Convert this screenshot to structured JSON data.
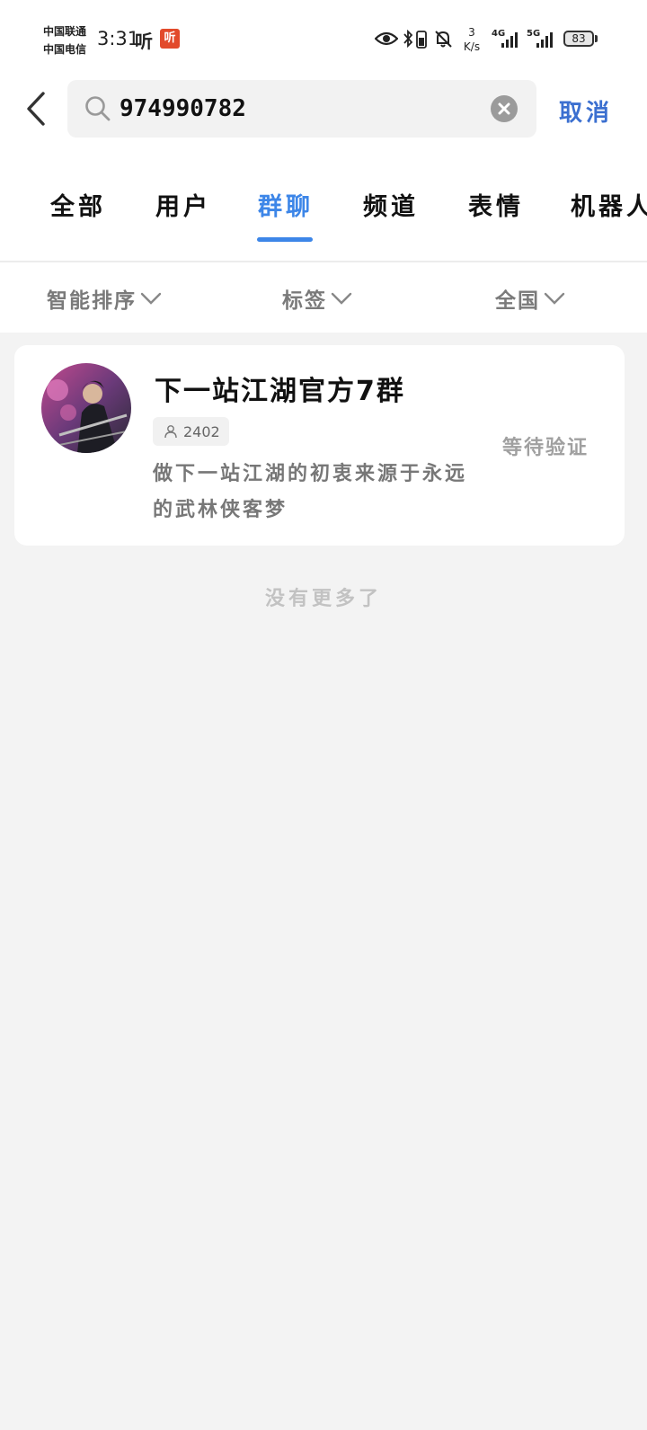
{
  "status_bar": {
    "carrier_1": "中国联通",
    "carrier_2": "中国电信",
    "time": "3:31",
    "app_notification_text": "听",
    "app_notification_badge": "听",
    "net_speed_value": "3",
    "net_speed_unit": "K/s",
    "network_1": "4G",
    "network_2": "5G",
    "battery": "83"
  },
  "search": {
    "query": "974990782",
    "cancel_label": "取消"
  },
  "tabs": [
    {
      "label": "全部",
      "active": false
    },
    {
      "label": "用户",
      "active": false
    },
    {
      "label": "群聊",
      "active": true
    },
    {
      "label": "频道",
      "active": false
    },
    {
      "label": "表情",
      "active": false
    },
    {
      "label": "机器人",
      "active": false
    }
  ],
  "filters": {
    "sort": "智能排序",
    "tag": "标签",
    "region": "全国"
  },
  "results": [
    {
      "name": "下一站江湖官方7群",
      "member_count": "2402",
      "description": "做下一站江湖的初衷来源于永远的武林侠客梦",
      "status": "等待验证"
    }
  ],
  "footer": {
    "no_more": "没有更多了"
  },
  "colors": {
    "accent": "#3d86e8",
    "cancel": "#3b6fd0",
    "background": "#f3f3f3",
    "badge_red": "#e24a2b"
  }
}
